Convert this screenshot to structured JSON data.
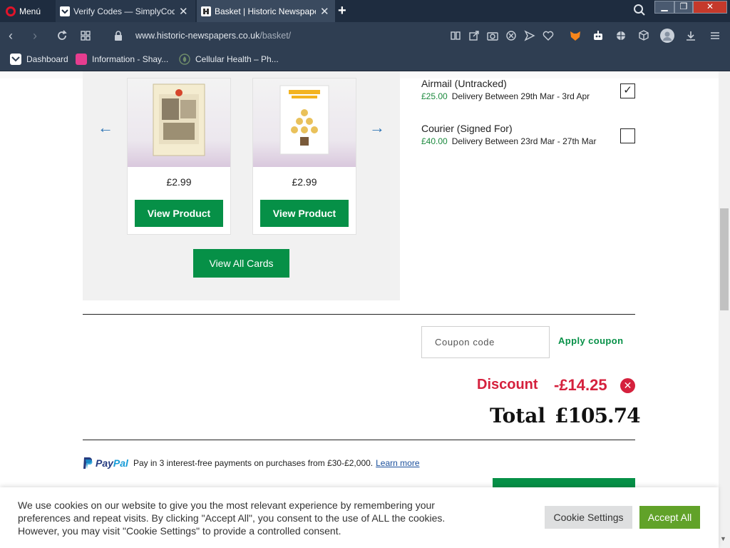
{
  "browser": {
    "menu_label": "Menú",
    "tabs": [
      {
        "title": "Verify Codes — SimplyCodes"
      },
      {
        "title": "Basket | Historic Newspapers"
      }
    ],
    "url_host": "www.historic-newspapers.co.uk",
    "url_path": "/basket/",
    "bookmarks": [
      {
        "label": "Dashboard"
      },
      {
        "label": "Information - Shay..."
      },
      {
        "label": "Cellular Health – Ph..."
      }
    ]
  },
  "carousel": {
    "cards": [
      {
        "price": "£2.99",
        "button": "View Product"
      },
      {
        "price": "£2.99",
        "button": "View Product"
      }
    ],
    "view_all": "View All Cards"
  },
  "shipping": [
    {
      "name": "Airmail (Untracked)",
      "price": "£25.00",
      "delivery": "Delivery Between 29th Mar - 3rd Apr",
      "checked": true
    },
    {
      "name": "Courier (Signed For)",
      "price": "£40.00",
      "delivery": "Delivery Between 23rd Mar - 27th Mar",
      "checked": false
    }
  ],
  "coupon": {
    "placeholder": "Coupon code",
    "apply": "Apply coupon"
  },
  "totals": {
    "discount_label": "Discount",
    "discount_value": "-£14.25",
    "total_label": "Total",
    "total_value": "£105.74"
  },
  "paypal": {
    "logo_pay": "Pay",
    "logo_pal": "Pal",
    "text": "Pay in 3 interest-free payments on purchases from £30-£2,000.",
    "learn_more": "Learn more"
  },
  "cookie": {
    "text": "We use cookies on our website to give you the most relevant experience by remembering your preferences and repeat visits. By clicking \"Accept All\", you consent to the use of ALL the cookies. However, you may visit \"Cookie Settings\" to provide a controlled consent.",
    "settings_label": "Cookie Settings",
    "accept_label": "Accept All"
  },
  "colors": {
    "accent_green": "#069047",
    "discount_red": "#d5213d",
    "accept_green": "#61a229"
  }
}
